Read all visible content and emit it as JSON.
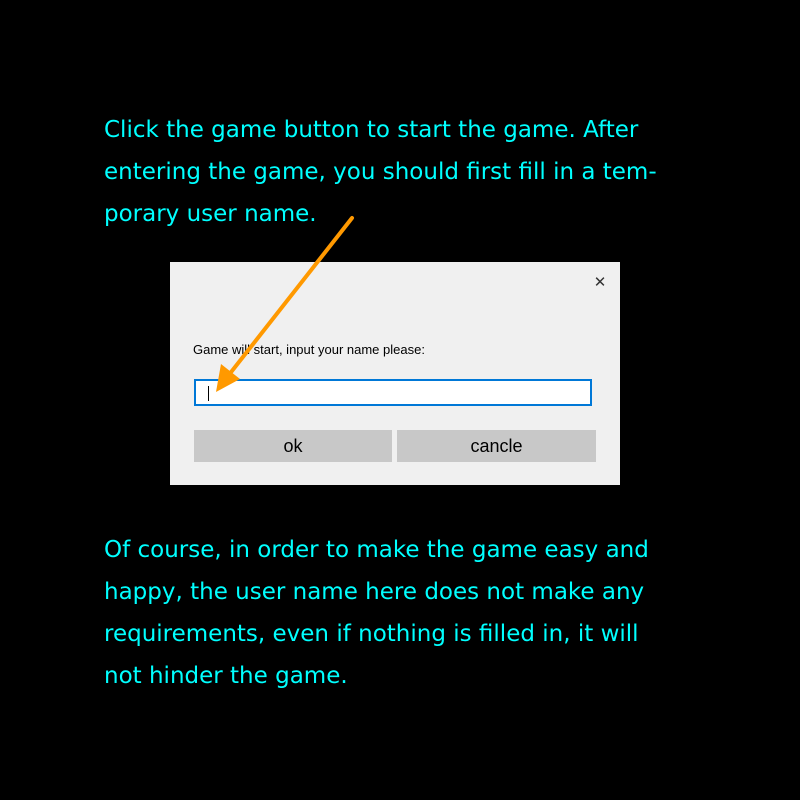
{
  "instructions": {
    "intro_lines": [
      "Click the game button to start the game. After",
      "entering the game, you should first fill in a tem-",
      "porary user name."
    ],
    "outro_lines": [
      "Of course, in order to make the game easy and",
      "happy, the user name here does not make any",
      "requirements, even if nothing is filled in, it will",
      "not hinder the game."
    ]
  },
  "dialog": {
    "close_glyph": "✕",
    "prompt": "Game will start, input your name please:",
    "input_value": "",
    "ok_label": "ok",
    "cancel_label": "cancle"
  },
  "colors": {
    "background": "#000000",
    "text": "#00ffff",
    "arrow": "#ff9900",
    "input_border": "#0078d7",
    "button": "#c8c8c8"
  }
}
